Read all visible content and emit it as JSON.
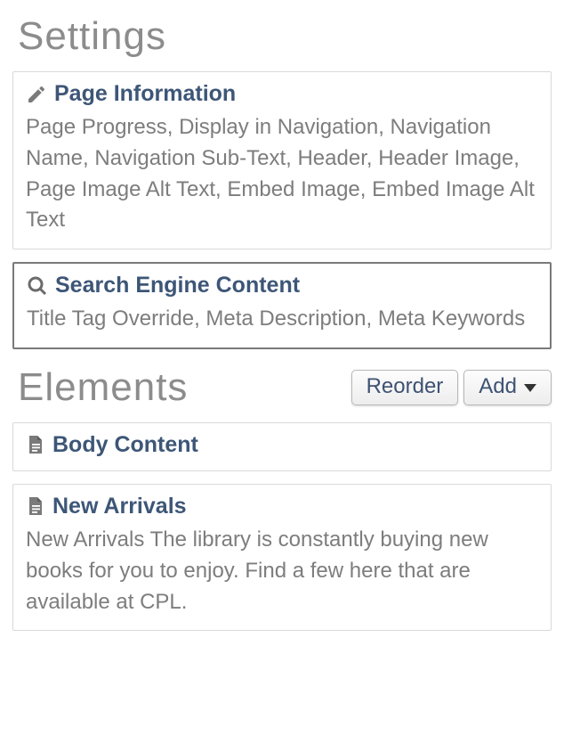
{
  "settings": {
    "heading": "Settings",
    "cards": [
      {
        "icon": "edit-icon",
        "title": "Page Information",
        "desc": "Page Progress, Display in Navigation, Navigation Name, Navigation Sub-Text, Header, Header Image, Page Image Alt Text, Embed Image, Embed Image Alt Text",
        "selected": false
      },
      {
        "icon": "search-icon",
        "title": "Search Engine Content",
        "desc": "Title Tag Override, Meta Description, Meta Keywords",
        "selected": true
      }
    ]
  },
  "elements": {
    "heading": "Elements",
    "reorder_label": "Reorder",
    "add_label": "Add",
    "cards": [
      {
        "icon": "document-icon",
        "title": "Body Content",
        "desc": ""
      },
      {
        "icon": "document-icon",
        "title": "New Arrivals",
        "desc": "New Arrivals The library is constantly buying new books for you to enjoy. Find a few here that are available at CPL."
      }
    ]
  }
}
